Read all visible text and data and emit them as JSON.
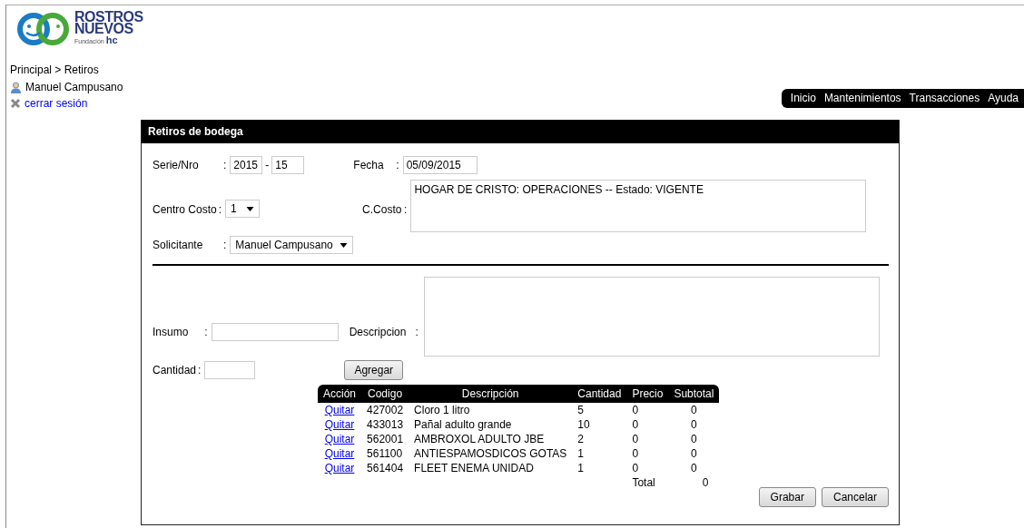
{
  "logo": {
    "line1": "ROSTROS",
    "line2": "NUEVOS",
    "sub": "Fundación",
    "sub_mark": "hc"
  },
  "breadcrumb": "Principal > Retiros",
  "user": "Manuel Campusano",
  "logout": "cerrar sesión",
  "nav": [
    "Inicio",
    "Mantenimientos",
    "Transacciones",
    "Ayuda"
  ],
  "panel": {
    "title": "Retiros de bodega",
    "colons": [
      ":",
      ":",
      ":",
      ":",
      ":",
      ":",
      ":",
      ":"
    ],
    "dash": "-",
    "serie_label": "Serie/Nro",
    "serie": "2015",
    "nro": "15",
    "fecha_label": "Fecha",
    "fecha": "05/09/2015",
    "centro_label": "Centro Costo",
    "centro": "1",
    "ccosto_label": "C.Costo",
    "ccosto": "HOGAR DE CRISTO: OPERACIONES -- Estado: VIGENTE",
    "solicitante_label": "Solicitante",
    "solicitante": "Manuel Campusano",
    "insumo_label": "Insumo",
    "descripcion_label": "Descripcion",
    "cantidad_label": "Cantidad",
    "add_button": "Agregar"
  },
  "table": {
    "columns": [
      "Acción",
      "Codigo",
      "Descripción",
      "Cantidad",
      "Precio",
      "Subtotal"
    ],
    "rows": [
      {
        "action": "Quitar",
        "code": "427002",
        "description": "Cloro 1 litro",
        "qty": "5",
        "price": "0",
        "subtotal": "0"
      },
      {
        "action": "Quitar",
        "code": "433013",
        "description": "Pañal adulto grande",
        "qty": "10",
        "price": "0",
        "subtotal": "0"
      },
      {
        "action": "Quitar",
        "code": "562001",
        "description": "AMBROXOL ADULTO JBE",
        "qty": "2",
        "price": "0",
        "subtotal": "0"
      },
      {
        "action": "Quitar",
        "code": "561100",
        "description": "ANTIESPAMOSDICOS GOTAS",
        "qty": "1",
        "price": "0",
        "subtotal": "0"
      },
      {
        "action": "Quitar",
        "code": "561404",
        "description": "FLEET ENEMA UNIDAD",
        "qty": "1",
        "price": "0",
        "subtotal": "0"
      }
    ],
    "total_label": "Total",
    "total": "0"
  },
  "buttons": [
    "Grabar",
    "Cancelar"
  ]
}
